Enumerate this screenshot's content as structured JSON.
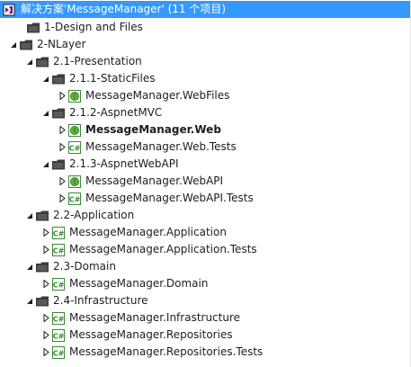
{
  "solution": {
    "label": "解决方案'MessageManager' (11 个项目)",
    "icon": "solution-icon"
  },
  "items": [
    {
      "label": "1-Design and Files",
      "icon": "solution-folder-icon",
      "expander": "none"
    },
    {
      "label": "2-NLayer",
      "icon": "solution-folder-icon",
      "expander": "expanded"
    },
    {
      "label": "2.1-Presentation",
      "icon": "solution-folder-icon",
      "expander": "expanded"
    },
    {
      "label": "2.1.1-StaticFiles",
      "icon": "solution-folder-icon",
      "expander": "expanded"
    },
    {
      "label": "MessageManager.WebFiles",
      "icon": "web-project-icon",
      "expander": "collapsed"
    },
    {
      "label": "2.1.2-AspnetMVC",
      "icon": "solution-folder-icon",
      "expander": "expanded"
    },
    {
      "label": "MessageManager.Web",
      "icon": "web-project-icon",
      "expander": "collapsed",
      "bold": true
    },
    {
      "label": "MessageManager.Web.Tests",
      "icon": "csharp-project-icon",
      "expander": "collapsed"
    },
    {
      "label": "2.1.3-AspnetWebAPI",
      "icon": "solution-folder-icon",
      "expander": "expanded"
    },
    {
      "label": "MessageManager.WebAPI",
      "icon": "web-project-icon",
      "expander": "collapsed"
    },
    {
      "label": "MessageManager.WebAPI.Tests",
      "icon": "csharp-project-icon",
      "expander": "collapsed"
    },
    {
      "label": "2.2-Application",
      "icon": "solution-folder-icon",
      "expander": "expanded"
    },
    {
      "label": "MessageManager.Application",
      "icon": "csharp-project-icon",
      "expander": "collapsed"
    },
    {
      "label": "MessageManager.Application.Tests",
      "icon": "csharp-project-icon",
      "expander": "collapsed"
    },
    {
      "label": "2.3-Domain",
      "icon": "solution-folder-icon",
      "expander": "expanded"
    },
    {
      "label": "MessageManager.Domain",
      "icon": "csharp-project-icon",
      "expander": "collapsed"
    },
    {
      "label": "2.4-Infrastructure",
      "icon": "solution-folder-icon",
      "expander": "expanded"
    },
    {
      "label": "MessageManager.Infrastructure",
      "icon": "csharp-project-icon",
      "expander": "collapsed"
    },
    {
      "label": "MessageManager.Repositories",
      "icon": "csharp-project-icon",
      "expander": "collapsed"
    },
    {
      "label": "MessageManager.Repositories.Tests",
      "icon": "csharp-project-icon",
      "expander": "collapsed"
    }
  ],
  "icon_badge_text": "C#",
  "colors": {
    "selection": "#3399ff",
    "folder": "#3c3c3c",
    "csharp_green": "#388a34",
    "web_globe": "#3a8a2e"
  }
}
